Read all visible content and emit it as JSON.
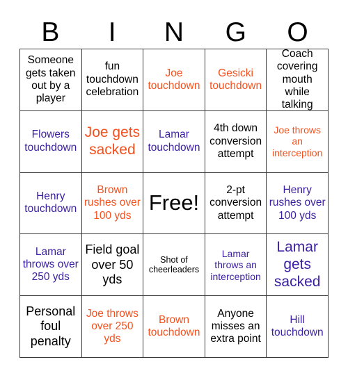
{
  "header": {
    "letters": [
      "B",
      "I",
      "N",
      "G",
      "O"
    ]
  },
  "grid": {
    "rows": 5,
    "columns": 5,
    "colors": {
      "black": "#000000",
      "orange": "#f4511e",
      "blue": "#3c1fa0",
      "border": "#3a3a3a",
      "background": "#ffffff"
    },
    "cells": [
      [
        {
          "text": "Someone gets taken out by a player",
          "color": "black",
          "size": "md"
        },
        {
          "text": "fun touchdown celebration",
          "color": "black",
          "size": "md"
        },
        {
          "text": "Joe touchdown",
          "color": "orange",
          "size": "md"
        },
        {
          "text": "Gesicki touchdown",
          "color": "orange",
          "size": "md"
        },
        {
          "text": "Coach covering mouth while talking",
          "color": "black",
          "size": "md"
        }
      ],
      [
        {
          "text": "Flowers touchdown",
          "color": "blue",
          "size": "md"
        },
        {
          "text": "Joe gets sacked",
          "color": "orange",
          "size": "xl"
        },
        {
          "text": "Lamar touchdown",
          "color": "blue",
          "size": "md"
        },
        {
          "text": "4th down conversion attempt",
          "color": "black",
          "size": "md"
        },
        {
          "text": "Joe throws an interception",
          "color": "orange",
          "size": "sm"
        }
      ],
      [
        {
          "text": "Henry touchdown",
          "color": "blue",
          "size": "md"
        },
        {
          "text": "Brown rushes over 100 yds",
          "color": "orange",
          "size": "md"
        },
        {
          "text": "Free!",
          "color": "black",
          "size": "free"
        },
        {
          "text": "2-pt conversion attempt",
          "color": "black",
          "size": "md"
        },
        {
          "text": "Henry rushes over 100 yds",
          "color": "blue",
          "size": "md"
        }
      ],
      [
        {
          "text": "Lamar throws over 250 yds",
          "color": "blue",
          "size": "md"
        },
        {
          "text": "Field goal over 50 yds",
          "color": "black",
          "size": "lg"
        },
        {
          "text": "Shot of cheerleaders",
          "color": "black",
          "size": "xs"
        },
        {
          "text": "Lamar throws an interception",
          "color": "blue",
          "size": "sm"
        },
        {
          "text": "Lamar gets sacked",
          "color": "blue",
          "size": "xl"
        }
      ],
      [
        {
          "text": "Personal foul penalty",
          "color": "black",
          "size": "lg"
        },
        {
          "text": "Joe throws over 250 yds",
          "color": "orange",
          "size": "md"
        },
        {
          "text": "Brown touchdown",
          "color": "orange",
          "size": "md"
        },
        {
          "text": "Anyone misses an extra point",
          "color": "black",
          "size": "md"
        },
        {
          "text": "Hill touchdown",
          "color": "blue",
          "size": "md"
        }
      ]
    ]
  }
}
